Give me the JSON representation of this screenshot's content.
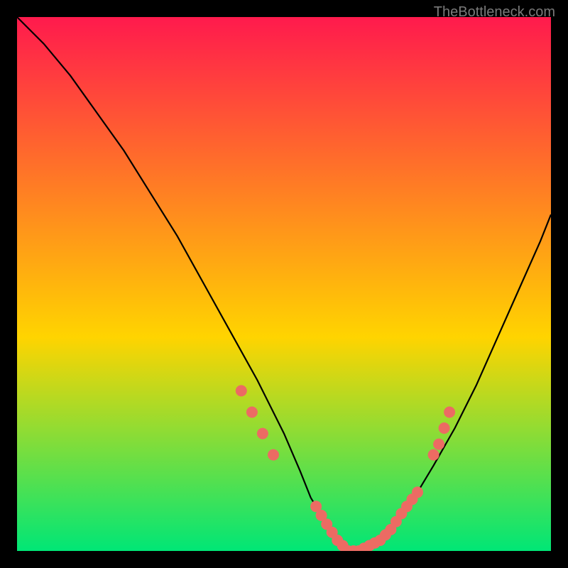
{
  "watermark": "TheBottleneck.com",
  "chart_data": {
    "type": "line",
    "title": "",
    "xlabel": "",
    "ylabel": "",
    "xlim": [
      0,
      100
    ],
    "ylim": [
      0,
      100
    ],
    "background_gradient": {
      "top": "#ff1a4d",
      "mid": "#ffd400",
      "bottom": "#00e676"
    },
    "series": [
      {
        "name": "curve",
        "x": [
          0,
          5,
          10,
          15,
          20,
          25,
          30,
          35,
          40,
          45,
          50,
          53,
          55,
          58,
          60,
          62,
          64,
          66,
          68,
          70,
          72,
          75,
          78,
          82,
          86,
          90,
          94,
          98,
          100
        ],
        "y": [
          100,
          95,
          89,
          82,
          75,
          67,
          59,
          50,
          41,
          32,
          22,
          15,
          10,
          5,
          2,
          0,
          0,
          1,
          2,
          4,
          7,
          11,
          16,
          23,
          31,
          40,
          49,
          58,
          63
        ],
        "color": "#000000"
      }
    ],
    "marker_band": {
      "name": "highlight-dots",
      "color": "#ec6b63",
      "points_x": [
        56,
        57,
        58,
        59,
        60,
        61,
        62,
        63,
        64,
        65,
        66,
        67,
        68,
        69,
        70,
        71,
        72,
        73,
        74,
        75
      ],
      "y_source": "curve"
    },
    "side_marker_clusters": [
      {
        "points_x": [
          42,
          44,
          46,
          48
        ],
        "y_approx": [
          30,
          26,
          22,
          18
        ],
        "color": "#ec6b63"
      },
      {
        "points_x": [
          78,
          79,
          80,
          81
        ],
        "y_approx": [
          18,
          20,
          23,
          26
        ],
        "color": "#ec6b63"
      }
    ]
  }
}
